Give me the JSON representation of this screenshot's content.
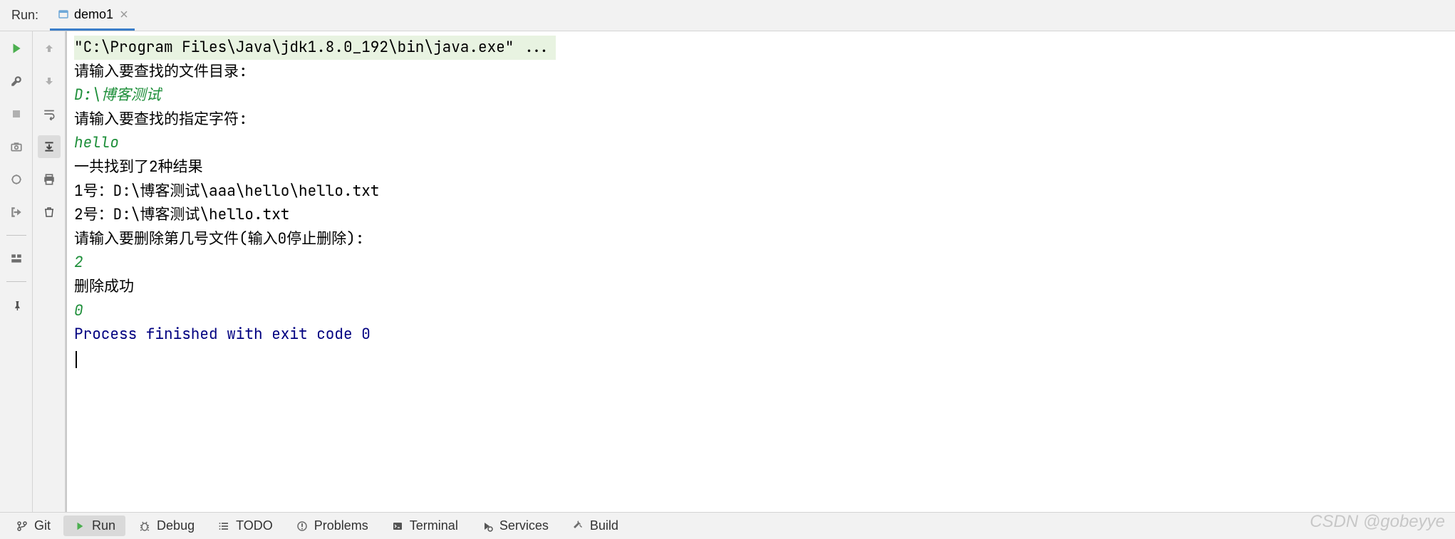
{
  "header": {
    "run_label": "Run:",
    "tab": {
      "label": "demo1"
    }
  },
  "console": {
    "lines": [
      {
        "text": "\"C:\\Program Files\\Java\\jdk1.8.0_192\\bin\\java.exe\" ...",
        "style": "highlight txt-black"
      },
      {
        "text": "请输入要查找的文件目录:",
        "style": "txt-black"
      },
      {
        "text": "D:\\博客测试",
        "style": "txt-green-italic"
      },
      {
        "text": "请输入要查找的指定字符:",
        "style": "txt-black"
      },
      {
        "text": "hello",
        "style": "txt-green-italic"
      },
      {
        "text": "一共找到了2种结果",
        "style": "txt-black"
      },
      {
        "text": "1号：D:\\博客测试\\aaa\\hello\\hello.txt",
        "style": "txt-black"
      },
      {
        "text": "2号：D:\\博客测试\\hello.txt",
        "style": "txt-black"
      },
      {
        "text": "请输入要删除第几号文件(输入0停止删除):",
        "style": "txt-black"
      },
      {
        "text": "2",
        "style": "txt-green-italic"
      },
      {
        "text": "删除成功",
        "style": "txt-black"
      },
      {
        "text": "0",
        "style": "txt-green-italic"
      },
      {
        "text": "",
        "style": ""
      },
      {
        "text": "Process finished with exit code 0",
        "style": "txt-navy"
      }
    ]
  },
  "footer": {
    "items": [
      {
        "label": "Git",
        "icon": "branch"
      },
      {
        "label": "Run",
        "icon": "play",
        "active": true
      },
      {
        "label": "Debug",
        "icon": "bug"
      },
      {
        "label": "TODO",
        "icon": "list"
      },
      {
        "label": "Problems",
        "icon": "warning"
      },
      {
        "label": "Terminal",
        "icon": "terminal"
      },
      {
        "label": "Services",
        "icon": "services"
      },
      {
        "label": "Build",
        "icon": "hammer"
      }
    ]
  },
  "watermark": "CSDN @gobeyye"
}
